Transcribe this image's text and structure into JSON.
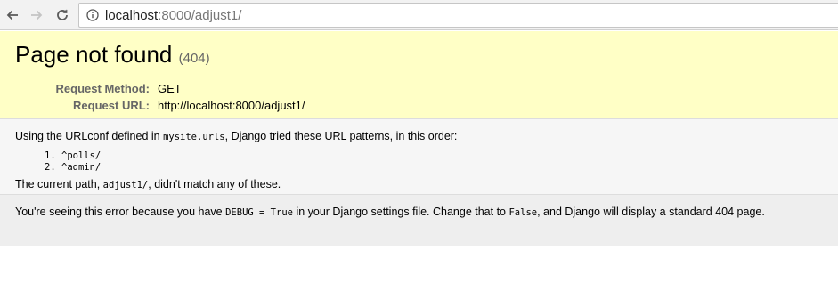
{
  "browser": {
    "url_host": "localhost",
    "url_rest": ":8000/adjust1/",
    "icons": [
      "back-arrow-icon",
      "forward-arrow-icon",
      "reload-icon",
      "info-icon"
    ]
  },
  "summary": {
    "title": "Page not found",
    "code": "(404)",
    "request_method_label": "Request Method:",
    "request_method": "GET",
    "request_url_label": "Request URL:",
    "request_url": "http://localhost:8000/adjust1/"
  },
  "info": {
    "line1_pre": "Using the URLconf defined in ",
    "line1_code": "mysite.urls",
    "line1_post": ", Django tried these URL patterns, in this order:",
    "patterns": [
      "^polls/",
      "^admin/"
    ],
    "line2_pre": "The current path, ",
    "line2_code": "adjust1/",
    "line2_post": ", didn't match any of these."
  },
  "explanation": {
    "pre": "You're seeing this error because you have ",
    "code1": "DEBUG = True",
    "mid": " in your Django settings file. Change that to ",
    "code2": "False",
    "post": ", and Django will display a standard 404 page."
  },
  "colors": {
    "summary_bg": "#ffffc6",
    "info_bg": "#f6f6f6",
    "explanation_bg": "#eeeeee"
  }
}
